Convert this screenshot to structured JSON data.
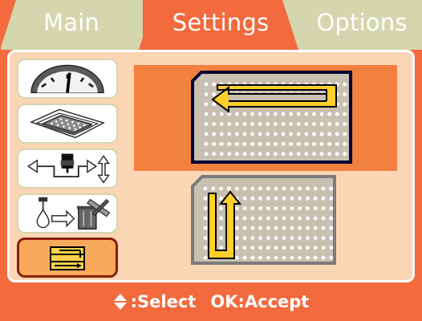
{
  "tabs": [
    {
      "label": "Main",
      "active": false
    },
    {
      "label": "Settings",
      "active": true
    },
    {
      "label": "Options",
      "active": false
    }
  ],
  "sidebar": {
    "items": [
      {
        "icon": "gauge-icon",
        "selected": false
      },
      {
        "icon": "plate-icon",
        "selected": false
      },
      {
        "icon": "probe-height-icon",
        "selected": false
      },
      {
        "icon": "dispense-waste-icon",
        "selected": false
      },
      {
        "icon": "direction-pattern-icon",
        "selected": true
      }
    ]
  },
  "patterns": [
    {
      "icon": "row-wise-pattern-icon",
      "selected": true
    },
    {
      "icon": "column-wise-pattern-icon",
      "selected": false
    }
  ],
  "footer": {
    "select_icon": "up-down-arrows-icon",
    "select_label": ":Select",
    "accept_label": "OK:Accept"
  },
  "colors": {
    "background": "#f26a3d",
    "tab_inactive": "#d4d7ad",
    "panel": "#fbd6b5",
    "selected_highlight": "#f2803f",
    "plate_fill": "#c8c0b1",
    "plate_dot": "#ffffff",
    "path_yellow": "#ffcf2a",
    "dark_outline": "#000033",
    "gray_outline": "#7b7b7b"
  }
}
